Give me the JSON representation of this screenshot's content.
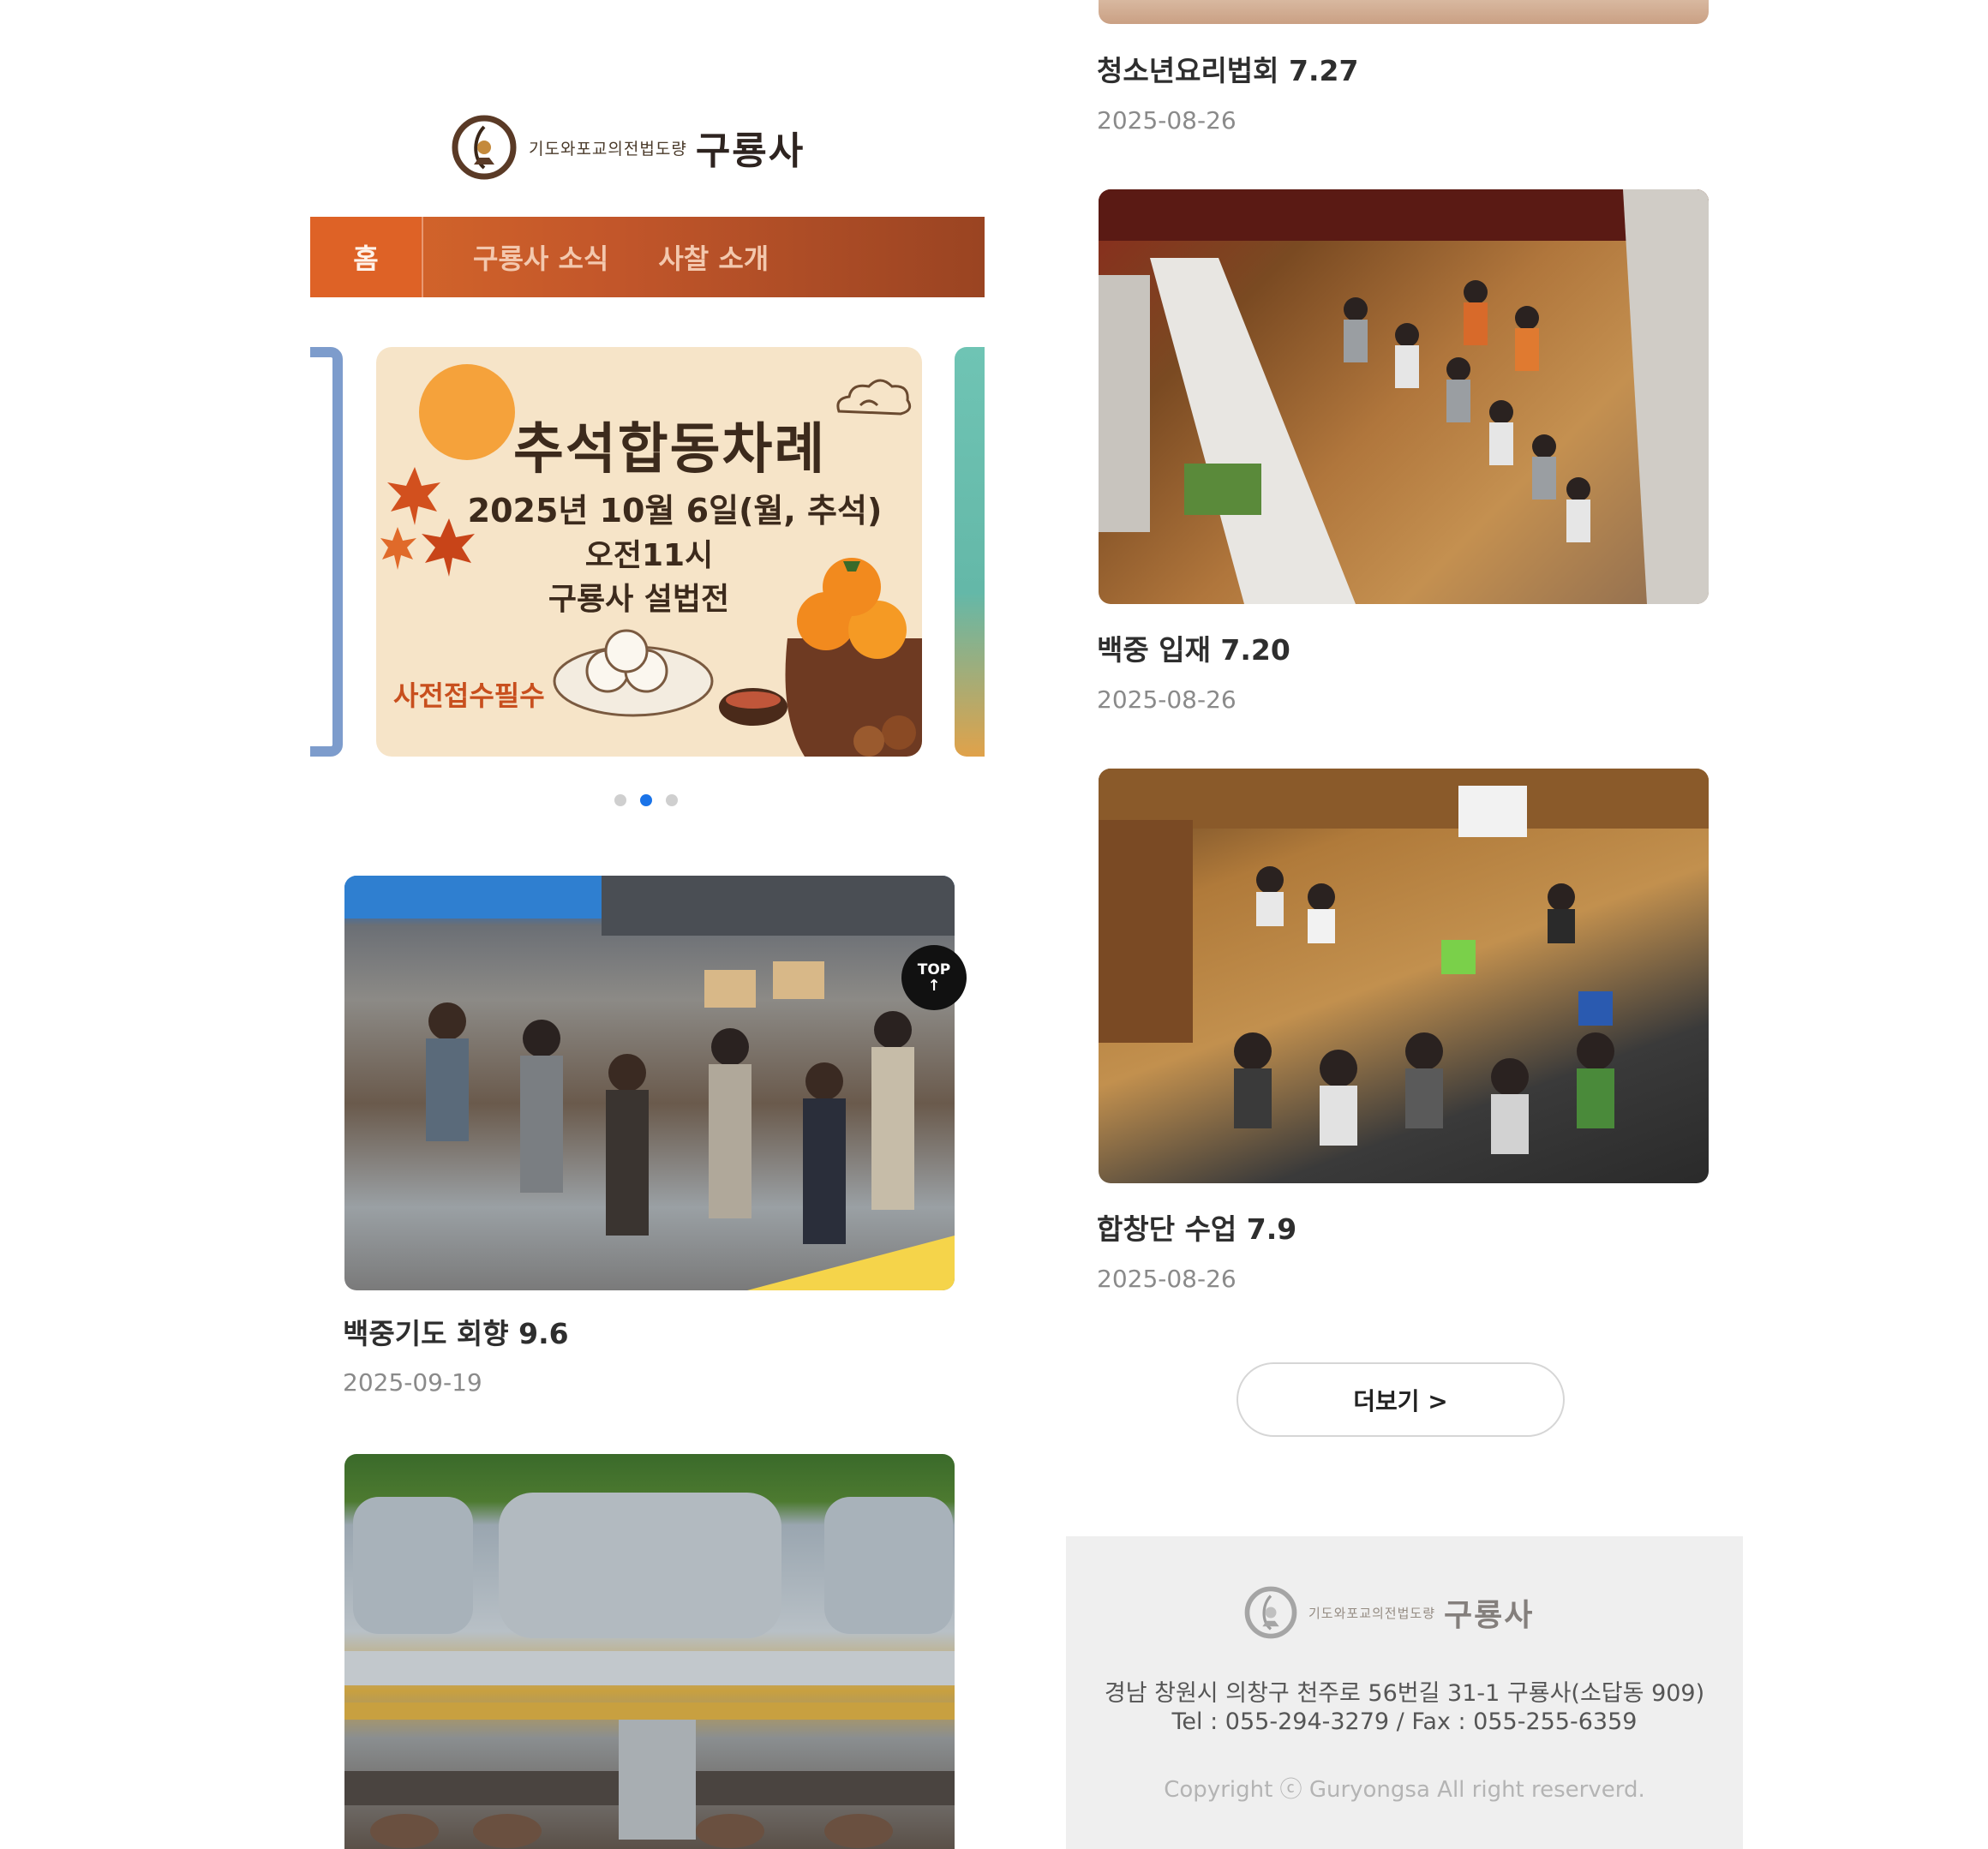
{
  "site": {
    "logo_sub": "기도와포교의전법도량",
    "logo_name": "구룡사"
  },
  "nav": {
    "home": "홈",
    "items": [
      "구룡사 소식",
      "사찰 소개"
    ]
  },
  "banner": {
    "title": "추석합동차례",
    "line1": "2025년 10월 6일(월, 추석)",
    "line2": "오전11시",
    "line3": "구룡사 설법전",
    "tag": "사전접수필수",
    "active_dot": 2,
    "dot_count": 3
  },
  "posts": [
    {
      "title": "청소년요리법회 7.27",
      "date": "2025-08-26"
    },
    {
      "title": "백중 입재 7.20",
      "date": "2025-08-26"
    },
    {
      "title": "합창단 수업 7.9",
      "date": "2025-08-26"
    },
    {
      "title": "백중기도 회향 9.6",
      "date": "2025-09-19"
    }
  ],
  "top_button": {
    "label": "TOP",
    "arrow": "↑"
  },
  "more_button": {
    "label": "더보기 >"
  },
  "footer": {
    "logo_sub": "기도와포교의전법도량",
    "logo_name": "구룡사",
    "address": "경남 창원시 의창구 천주로 56번길 31-1 구룡사(소답동 909)",
    "tel": "Tel : 055-294-3279 / Fax : 055-255-6359",
    "copyright": "Copyright ⓒ Guryongsa All right reserverd."
  },
  "colors": {
    "nav_start": "#d96a2b",
    "nav_end": "#9a4422",
    "dot_active": "#1a73e8",
    "footer_bg": "#efefef"
  }
}
